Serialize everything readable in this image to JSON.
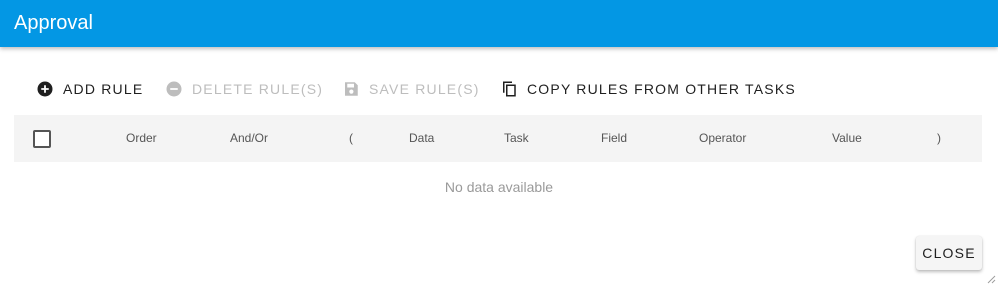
{
  "dialog": {
    "title": "Approval"
  },
  "toolbar": {
    "add_rule": "ADD RULE",
    "delete_rules": "DELETE RULE(S)",
    "save_rules": "SAVE RULE(S)",
    "copy_rules": "COPY RULES FROM OTHER TASKS"
  },
  "table": {
    "columns": [
      "Order",
      "And/Or",
      "(",
      "Data",
      "Task",
      "Field",
      "Operator",
      "Value",
      ")"
    ],
    "rows": [],
    "empty_text": "No data available"
  },
  "footer": {
    "close_label": "CLOSE"
  },
  "colors": {
    "header": "#0397e4",
    "disabled": "#bdbdbd"
  },
  "icons": {
    "add_rule": "plus-circle-icon",
    "delete_rules": "minus-circle-icon",
    "save_rules": "floppy-disk-icon",
    "copy_rules": "copy-icon"
  }
}
